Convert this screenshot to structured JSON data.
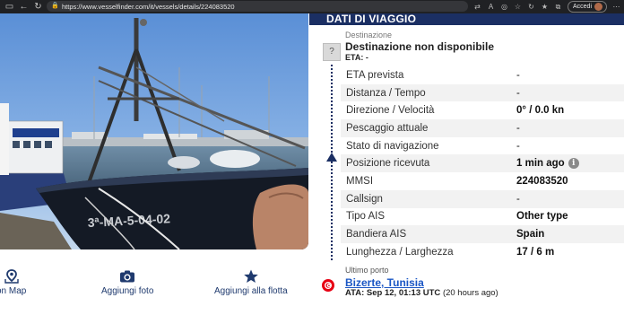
{
  "browser": {
    "url": "https://www.vesselfinder.com/it/vessels/details/224083520",
    "profile_button": "Accedi"
  },
  "photo": {
    "hull_text": "3ª-MA-5-04-02"
  },
  "actions": {
    "map_label": "on Map",
    "add_photo_label": "Aggiungi foto",
    "add_fleet_label": "Aggiungi alla flotta"
  },
  "voyage": {
    "section_title": "DATI DI VIAGGIO",
    "destination_label": "Destinazione",
    "destination_icon": "?",
    "destination_value": "Destinazione non disponibile",
    "eta_text": "ETA: -",
    "details": [
      {
        "label": "ETA prevista",
        "value": "-"
      },
      {
        "label": "Distanza / Tempo",
        "value": "-"
      },
      {
        "label": "Direzione / Velocità",
        "value": "0° / 0.0 kn"
      },
      {
        "label": "Pescaggio attuale",
        "value": "-"
      },
      {
        "label": "Stato di navigazione",
        "value": "-"
      },
      {
        "label": "Posizione ricevuta",
        "value": "1 min ago"
      },
      {
        "label": "MMSI",
        "value": "224083520"
      },
      {
        "label": "Callsign",
        "value": "-"
      },
      {
        "label": "Tipo AIS",
        "value": "Other type"
      },
      {
        "label": "Bandiera AIS",
        "value": "Spain"
      },
      {
        "label": "Lunghezza / Larghezza",
        "value": "17 / 6 m"
      }
    ],
    "last_port_label": "Ultimo porto",
    "last_port_name": "Bizerte, Tunisia",
    "last_port_ata": "ATA: Sep 12, 01:13 UTC",
    "last_port_ago": "(20 hours ago)"
  },
  "colors": {
    "header_bg": "#1b2f63",
    "link": "#1a56c4",
    "action_text": "#1f3a6e"
  }
}
